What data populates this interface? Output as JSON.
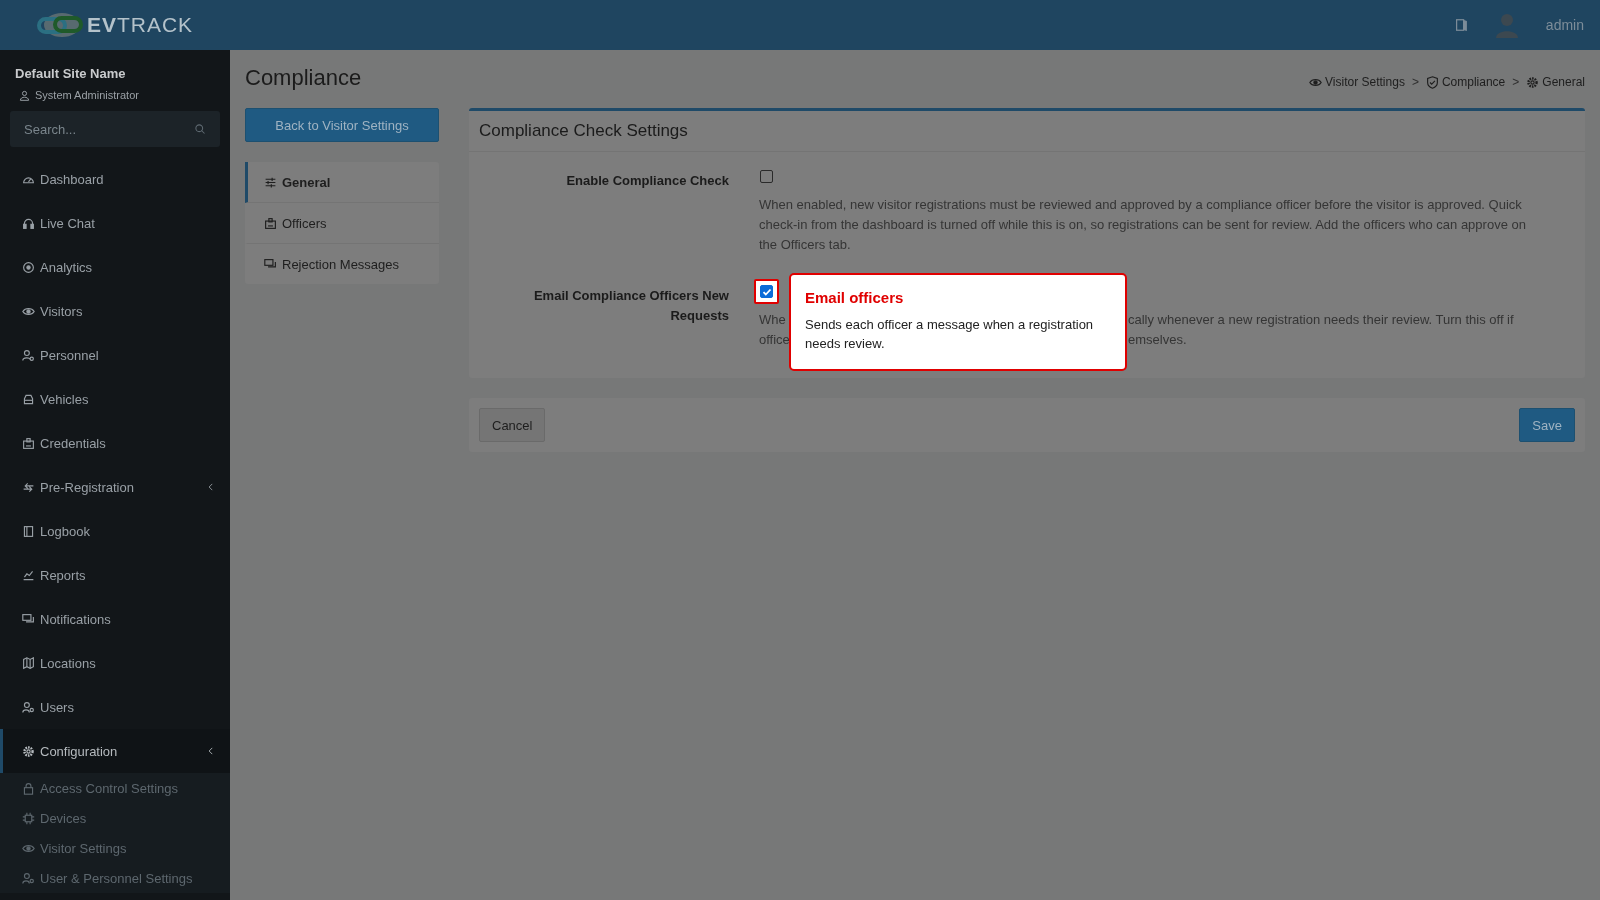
{
  "header": {
    "logo": "**EV**TRACK",
    "user": "admin"
  },
  "sidebar": {
    "site_name": "Default Site Name",
    "role": "System Administrator",
    "search": {
      "placeholder": "Search..."
    },
    "items": [
      {
        "label": "Dashboard",
        "kind": "link",
        "selected": false
      },
      {
        "label": "Live Chat",
        "kind": "link",
        "selected": false
      },
      {
        "label": "Analytics",
        "kind": "link",
        "selected": false
      },
      {
        "label": "Visitors",
        "kind": "link",
        "selected": false
      },
      {
        "label": "Personnel",
        "kind": "link",
        "selected": false
      },
      {
        "label": "Vehicles",
        "kind": "link",
        "selected": false
      },
      {
        "label": "Credentials",
        "kind": "link",
        "selected": false
      },
      {
        "label": "Pre-Registration",
        "kind": "group",
        "selected": false
      },
      {
        "label": "Logbook",
        "kind": "link",
        "selected": false
      },
      {
        "label": "Reports",
        "kind": "link",
        "selected": false
      },
      {
        "label": "Notifications",
        "kind": "link",
        "selected": false
      },
      {
        "label": "Locations",
        "kind": "link",
        "selected": false
      },
      {
        "label": "Users",
        "kind": "link",
        "selected": false
      },
      {
        "label": "Configuration",
        "kind": "group",
        "selected": true,
        "children": [
          {
            "label": "Access Control Settings",
            "selected": false
          },
          {
            "label": "Devices",
            "selected": false
          },
          {
            "label": "Visitor Settings",
            "selected": false
          },
          {
            "label": "User & Personnel Settings",
            "selected": false
          }
        ]
      }
    ]
  },
  "page": {
    "title": "Compliance",
    "breadcrumb": [
      {
        "label": "Visitor Settings"
      },
      {
        "label": "Compliance"
      },
      {
        "label": "General"
      }
    ],
    "breadcrumb_separators": [
      ">",
      ">"
    ],
    "back_button": "Back to Visitor Settings",
    "tabs": [
      {
        "label": "General",
        "selected": true
      },
      {
        "label": "Officers",
        "selected": false
      },
      {
        "label": "Rejection Messages",
        "selected": false
      }
    ],
    "settings": {
      "title": "Compliance Check Settings",
      "fields": [
        {
          "label": "Enable Compliance Check",
          "checked": false,
          "highlighted": false,
          "description": "When enabled, new visitor registrations must be reviewed and approved by a compliance officer before the visitor is approved. Quick check-in from the dashboard is turned off while this is on, so registrations can be sent for review. Add the officers who can approve on the Officers tab."
        },
        {
          "label": "Email Compliance Officers New Requests",
          "checked": true,
          "highlighted": true,
          "description_fragments": [
            [
              "Whe",
              "cally whenever a new registration needs their review. Turn this off if"
            ],
            [
              "office",
              "emselves."
            ]
          ],
          "tooltip": {
            "title": "Email officers",
            "text": "Sends each officer a message when a registration needs review."
          }
        }
      ]
    },
    "actions": {
      "cancel": "Cancel",
      "save": "Save"
    }
  }
}
